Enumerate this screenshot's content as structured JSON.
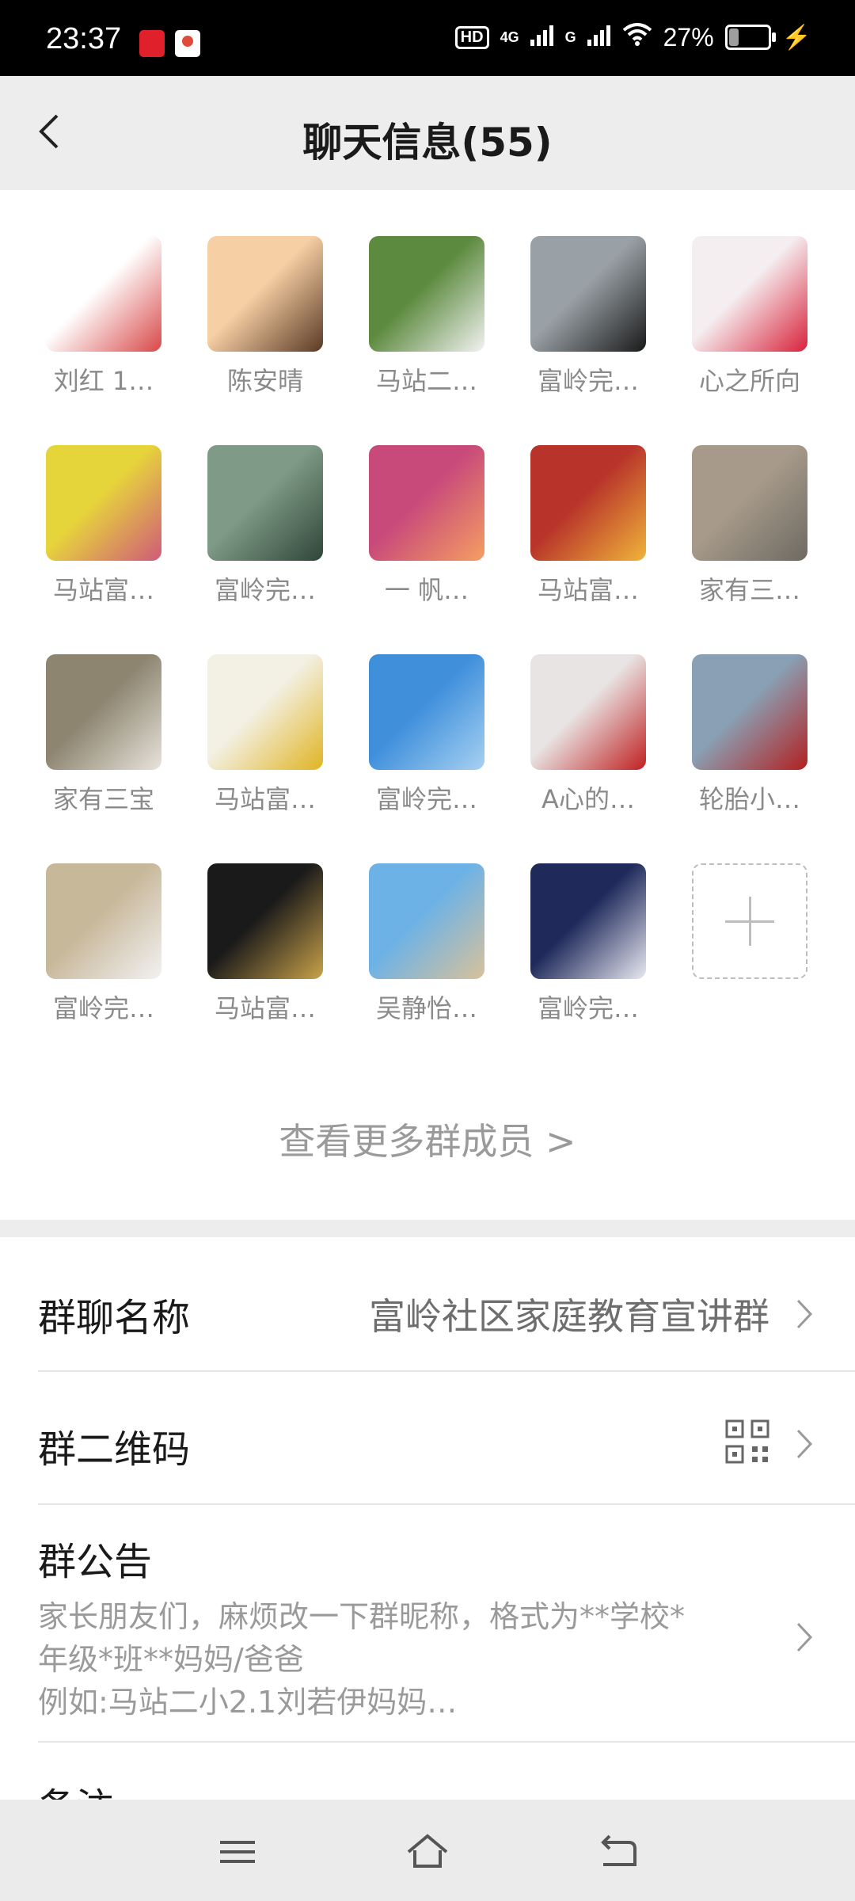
{
  "status_bar": {
    "time": "23:37",
    "hd_badge": "HD",
    "signal_1": "4G",
    "signal_2": "G",
    "battery_text": "27%",
    "battery_level": 0.27,
    "app_icon_colors": [
      "#e0202a",
      "#ffffff"
    ]
  },
  "header": {
    "title": "聊天信息(55)",
    "back_icon": "chevron-left-icon"
  },
  "members": [
    {
      "name": "刘红 1…",
      "colors": [
        "#ffffff",
        "#d94848"
      ]
    },
    {
      "name": "陈安晴",
      "colors": [
        "#f7cfa4",
        "#5a3a26"
      ]
    },
    {
      "name": "马站二…",
      "colors": [
        "#5c8a3e",
        "#f2f2f2"
      ]
    },
    {
      "name": "富岭完…",
      "colors": [
        "#9aa1a6",
        "#1a1a1a"
      ]
    },
    {
      "name": "心之所向",
      "colors": [
        "#f5eef0",
        "#d8223a"
      ]
    },
    {
      "name": "马站富…",
      "colors": [
        "#e6d53a",
        "#d05a7a"
      ]
    },
    {
      "name": "富岭完…",
      "colors": [
        "#7f9a86",
        "#2f4638"
      ]
    },
    {
      "name": "一 帆…",
      "colors": [
        "#c84a7a",
        "#f59e62"
      ]
    },
    {
      "name": "马站富…",
      "colors": [
        "#b8342a",
        "#f0b43a"
      ]
    },
    {
      "name": "家有三…",
      "colors": [
        "#a79a8a",
        "#6d6a62"
      ]
    },
    {
      "name": "家有三宝",
      "colors": [
        "#8d8570",
        "#e8e4dc"
      ]
    },
    {
      "name": "马站富…",
      "colors": [
        "#f3f0e4",
        "#e0b423"
      ]
    },
    {
      "name": "富岭完…",
      "colors": [
        "#3f8fdb",
        "#a7d1f2"
      ]
    },
    {
      "name": "A心的…",
      "colors": [
        "#e8e4e4",
        "#c02020"
      ]
    },
    {
      "name": "轮胎小…",
      "colors": [
        "#8aa0b4",
        "#b22020"
      ]
    },
    {
      "name": "富岭完…",
      "colors": [
        "#c8b89a",
        "#f2f2f2"
      ]
    },
    {
      "name": "马站富…",
      "colors": [
        "#1a1a1a",
        "#c9a24a"
      ]
    },
    {
      "name": "吴静怡…",
      "colors": [
        "#6db2e6",
        "#d8c29a"
      ]
    },
    {
      "name": "富岭完…",
      "colors": [
        "#1f2a5a",
        "#e9e9f2"
      ]
    }
  ],
  "more_members": "查看更多群成员 >",
  "settings": {
    "group_name_label": "群聊名称",
    "group_name_value": "富岭社区家庭教育宣讲群",
    "qr_label": "群二维码",
    "qr_icon": "qr-code-icon",
    "notice_label": "群公告",
    "notice_line1": "家长朋友们，麻烦改一下群昵称，格式为**学校*",
    "notice_line2": "年级*班**妈妈/爸爸",
    "notice_line3": "例如:马站二小2.1刘若伊妈妈…",
    "remark_label": "备注"
  },
  "nav": {
    "menu_icon": "menu-icon",
    "home_icon": "home-icon",
    "back_icon": "back-arrow-icon"
  }
}
